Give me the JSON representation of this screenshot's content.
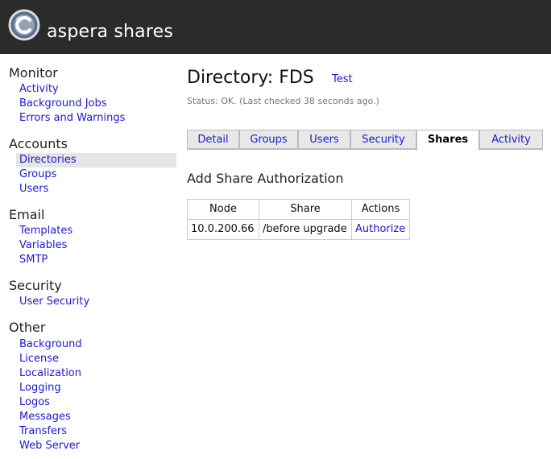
{
  "header": {
    "app_title": "aspera shares"
  },
  "sidebar": {
    "sections": [
      {
        "title": "Monitor",
        "items": [
          "Activity",
          "Background Jobs",
          "Errors and Warnings"
        ]
      },
      {
        "title": "Accounts",
        "items": [
          "Directories",
          "Groups",
          "Users"
        ]
      },
      {
        "title": "Email",
        "items": [
          "Templates",
          "Variables",
          "SMTP"
        ]
      },
      {
        "title": "Security",
        "items": [
          "User Security"
        ]
      },
      {
        "title": "Other",
        "items": [
          "Background",
          "License",
          "Localization",
          "Logging",
          "Logos",
          "Messages",
          "Transfers",
          "Web Server"
        ]
      }
    ],
    "active_item": "Directories"
  },
  "main": {
    "title": "Directory: FDS",
    "title_link": "Test",
    "status": "Status: OK. (Last checked 38 seconds ago.)",
    "tabs": [
      "Detail",
      "Groups",
      "Users",
      "Security",
      "Shares",
      "Activity"
    ],
    "active_tab": "Shares",
    "section_title": "Add Share Authorization",
    "table": {
      "headers": [
        "Node",
        "Share",
        "Actions"
      ],
      "rows": [
        {
          "node": "10.0.200.66",
          "share": "/before upgrade",
          "action": "Authorize"
        }
      ]
    }
  },
  "colors": {
    "header_bg": "#2b2b2b",
    "link": "#1a1acc",
    "active_nav_bg": "#e6e6e6",
    "tab_bg": "#e8e8e8"
  },
  "icons": {
    "logo": "aspera-logo-icon"
  }
}
